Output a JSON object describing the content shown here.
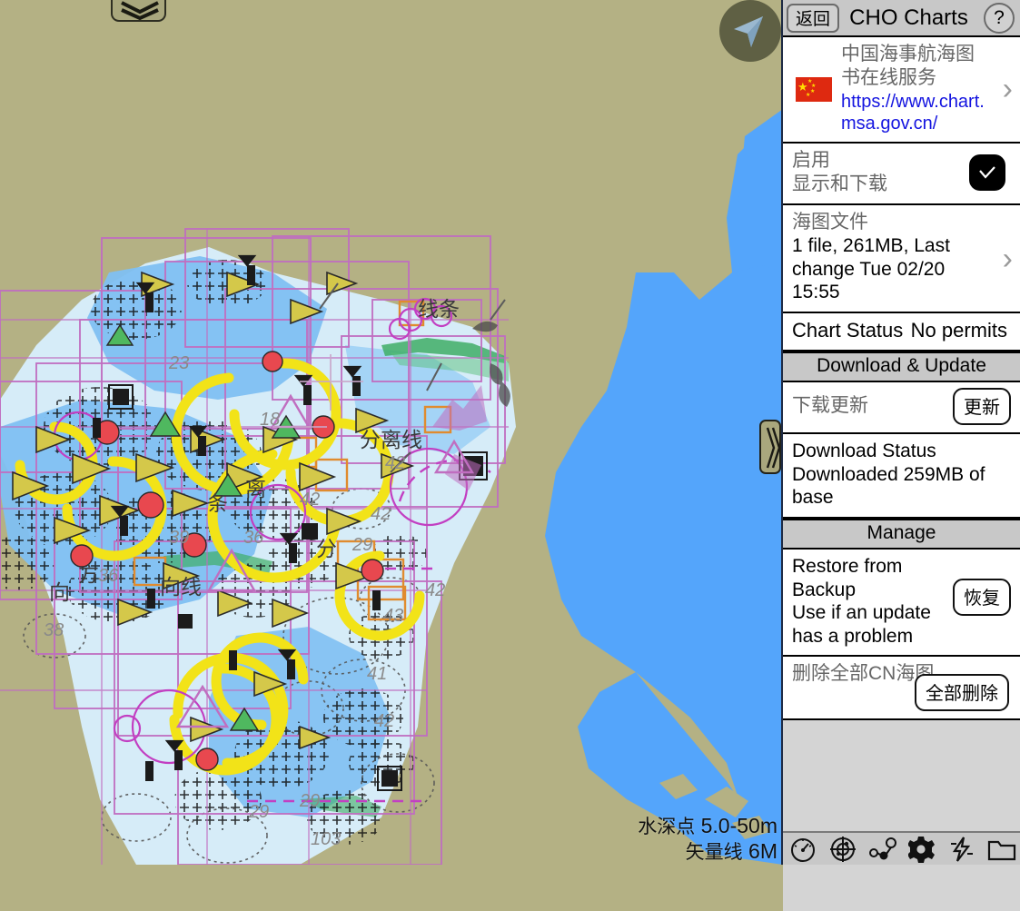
{
  "window": {
    "title": "CHO Charts"
  },
  "header": {
    "back_label": "返回",
    "help_label": "?"
  },
  "rows": {
    "service": {
      "name_cn": "中国海事航海图书在线服务",
      "url": "https://www.chart.msa.gov.cn/",
      "flag_icon": "china-flag-icon",
      "chevron": "›"
    },
    "enable": {
      "title": "启用",
      "subtitle": "显示和下载",
      "checked": true,
      "check_glyph": "✓"
    },
    "chart_files": {
      "title": "海图文件",
      "detail": "1 file, 261MB, Last change Tue 02/20 15:55",
      "chevron": "›"
    },
    "chart_status": {
      "label": "Chart Status",
      "value": "No permits"
    },
    "download_section": {
      "header": "Download & Update"
    },
    "download_update": {
      "label": "下载更新",
      "button": "更新"
    },
    "download_status": {
      "title": "Download Status",
      "detail": "Downloaded 259MB of base"
    },
    "manage_section": {
      "header": "Manage"
    },
    "restore": {
      "title": "Restore from Backup",
      "detail": "Use if an update has a problem",
      "button": "恢复"
    },
    "delete_all": {
      "title": "删除全部CN海图",
      "button": "全部删除"
    }
  },
  "map": {
    "legend": [
      {
        "label_cn": "水深点",
        "value": "5.0-50m"
      },
      {
        "label_cn": "矢量线",
        "value": "6M"
      }
    ],
    "colors": {
      "land": "#b4b184",
      "sea": "#54a5fb",
      "shallow": "#d6ecf8",
      "chart_boundary": "#c06ec0",
      "light_sector": "#f2e318",
      "compass_bg": "#5f6044",
      "compass_arrow": "#9ab8cf"
    },
    "compass_icon": "navigation-arrow-icon",
    "collapse_icon": "chevron-down-icon",
    "panel_handle_icon": "double-chevron-right-icon"
  },
  "toolbar": {
    "items": [
      {
        "icon": "gauge-icon",
        "active": false
      },
      {
        "icon": "radar-icon",
        "active": false
      },
      {
        "icon": "route-waypoints-icon",
        "active": false
      },
      {
        "icon": "gear-icon",
        "active": true
      },
      {
        "icon": "lightning-icon",
        "active": false
      },
      {
        "icon": "folder-icon",
        "active": false
      }
    ]
  }
}
